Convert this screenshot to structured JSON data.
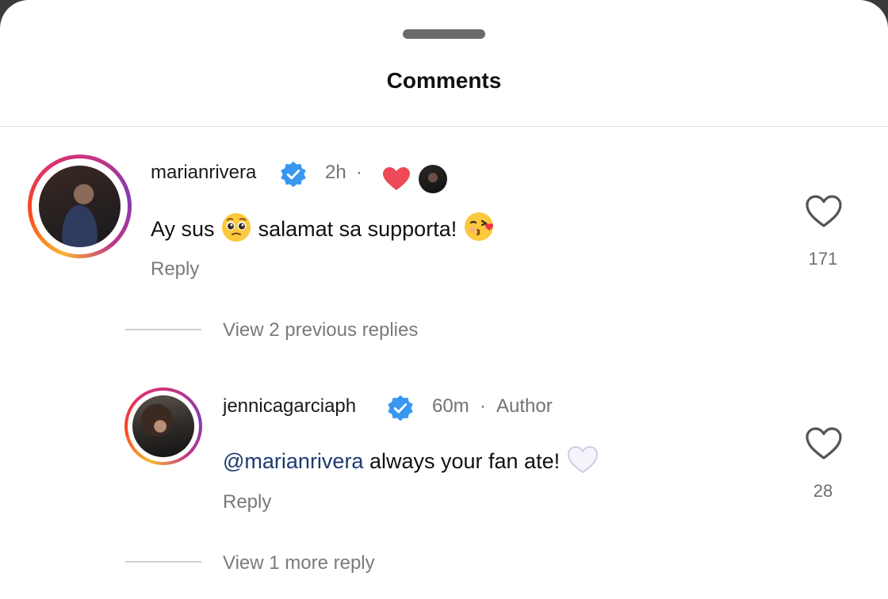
{
  "header": {
    "title": "Comments"
  },
  "comments": [
    {
      "username": "marianrivera",
      "time": "2h",
      "dot": "·",
      "text": "Ay sus",
      "text_after_emoji": "salamat sa supporta!",
      "reply_label": "Reply",
      "likes": "171",
      "view_replies": "View 2 previous replies"
    },
    {
      "username": "jennicagarciaph",
      "time": "60m",
      "dot": "·",
      "author_badge": "Author",
      "mention": "@marianrivera",
      "text": "always your fan ate!",
      "reply_label": "Reply",
      "likes": "28",
      "view_replies": "View 1 more reply"
    }
  ],
  "icons": {
    "verified": "verified-badge-icon",
    "heart": "heart-outline-icon",
    "liked_by_author": "red-heart-icon"
  },
  "colors": {
    "verified_blue": "#3897f0",
    "liked_red": "#ed4956",
    "mention_blue": "#1d3a6e",
    "secondary_text": "#737373"
  }
}
